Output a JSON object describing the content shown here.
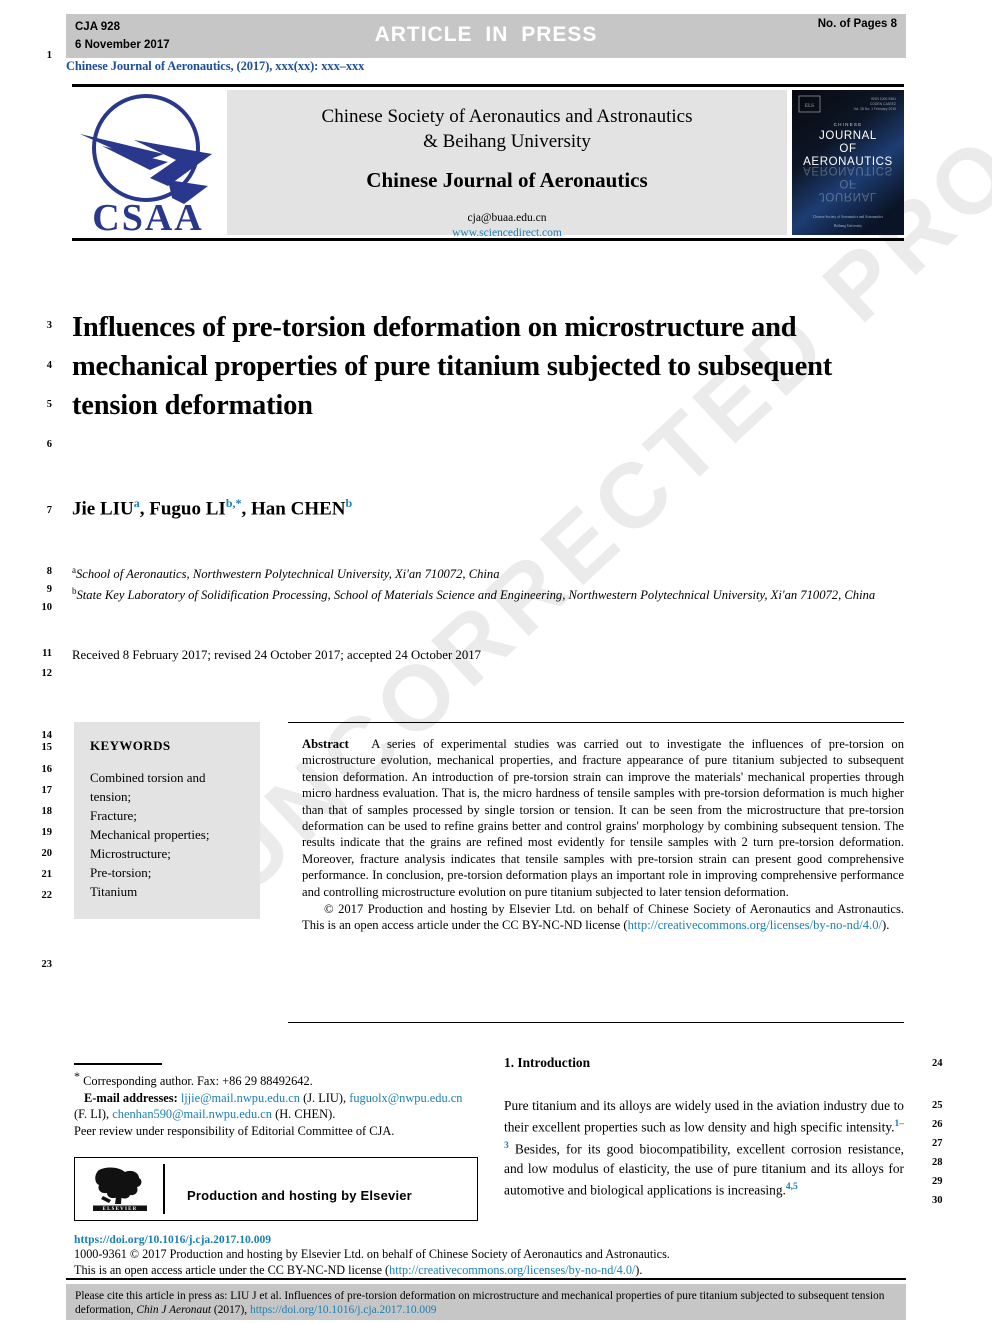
{
  "header": {
    "article_id": "CJA 928",
    "date": "6 November 2017",
    "status_banner": "ARTICLE IN PRESS",
    "pages_note": "No. of Pages 8",
    "running_head": "Chinese Journal of Aeronautics, (2017), xxx(xx): xxx–xxx"
  },
  "masthead": {
    "logo_text": "CSAA",
    "society_line1": "Chinese Society of Aeronautics and Astronautics",
    "society_line2": "& Beihang University",
    "journal_title": "Chinese Journal of Aeronautics",
    "email": "cja@buaa.edu.cn",
    "website": "www.sciencedirect.com",
    "cover": {
      "line1": "CHINESE",
      "line2": "JOURNAL",
      "line3": "OF",
      "line4": "AERONAUTICS",
      "footer1": "Chinese Society of Aeronautics and Astronautics",
      "footer2": "Beihang University"
    }
  },
  "article": {
    "title": "Influences of pre-torsion deformation on microstructure and mechanical properties of pure titanium subjected to subsequent tension deformation",
    "authors_html": "Jie LIU a, Fuguo LI b,*, Han CHEN b",
    "authors": [
      {
        "name": "Jie LIU",
        "marks": "a"
      },
      {
        "name": "Fuguo LI",
        "marks": "b,*"
      },
      {
        "name": "Han CHEN",
        "marks": "b"
      }
    ],
    "affiliations": [
      {
        "mark": "a",
        "text": "School of Aeronautics, Northwestern Polytechnical University, Xi'an 710072, China"
      },
      {
        "mark": "b",
        "text": "State Key Laboratory of Solidification Processing, School of Materials Science and Engineering, Northwestern Polytechnical University, Xi'an 710072, China"
      }
    ],
    "history": "Received 8 February 2017; revised 24 October 2017; accepted 24 October 2017"
  },
  "keywords": {
    "heading": "KEYWORDS",
    "items": [
      "Combined torsion and tension;",
      "Fracture;",
      "Mechanical properties;",
      "Microstructure;",
      "Pre-torsion;",
      "Titanium"
    ]
  },
  "abstract": {
    "label": "Abstract",
    "body": "A series of experimental studies was carried out to investigate the influences of pre-torsion on microstructure evolution, mechanical properties, and fracture appearance of pure titanium subjected to subsequent tension deformation. An introduction of pre-torsion strain can improve the materials' mechanical properties through micro hardness evaluation. That is, the micro hardness of tensile samples with pre-torsion deformation is much higher than that of samples processed by single torsion or tension. It can be seen from the microstructure that pre-torsion deformation can be used to refine grains better and control grains' morphology by combining subsequent tension. The results indicate that the grains are refined most evidently for tensile samples with 2 turn pre-torsion deformation. Moreover, fracture analysis indicates that tensile samples with pre-torsion strain can present good comprehensive performance. In conclusion, pre-torsion deformation plays an important role in improving comprehensive performance and controlling microstructure evolution on pure titanium subjected to later tension deformation.",
    "copyright_text": "© 2017 Production and hosting by Elsevier Ltd. on behalf of Chinese Society of Aeronautics and Astronautics. This is an open access article under the CC BY-NC-ND license (",
    "license_link": "http://creativecommons.org/licenses/by-no-nd/4.0/",
    "copyright_tail": ")."
  },
  "footnotes": {
    "corresponding": "Corresponding author. Fax: +86 29 88492642.",
    "email_label": "E-mail addresses:",
    "emails": [
      {
        "address": "ljjie@mail.nwpu.edu.cn",
        "owner": "(J. LIU),"
      },
      {
        "address": "fuguolx@nwpu.edu.cn",
        "owner": "(F. LI),"
      },
      {
        "address": "chenhan590@mail.nwpu.edu.cn",
        "owner": "(H. CHEN)."
      }
    ],
    "peer_review": "Peer review under responsibility of Editorial Committee of CJA.",
    "elsevier_banner": "Production and hosting by Elsevier",
    "elsevier_logo_label": "ELSEVIER"
  },
  "publisher": {
    "doi": "https://doi.org/10.1016/j.cja.2017.10.009",
    "issn_line": "1000-9361 © 2017 Production and hosting by Elsevier Ltd. on behalf of Chinese Society of Aeronautics and Astronautics.",
    "license_prefix": "This is an open access article under the CC BY-NC-ND license (",
    "license_link": "http://creativecommons.org/licenses/by-no-nd/4.0/",
    "license_suffix": ")."
  },
  "introduction": {
    "heading": "1. Introduction",
    "paragraph_a": "Pure titanium and its alloys are widely used in the aviation industry due to their excellent properties such as low density and high specific intensity.",
    "ref_1": "1–3",
    "paragraph_b": "Besides, for its good biocompatibility, excellent corrosion resistance, and low modulus of elasticity, the use of pure titanium and its alloys for automotive and biological applications is increasing.",
    "ref_2": "4,5"
  },
  "cite_footer": {
    "prefix": "Please cite this article in press as: LIU J et al. Influences of pre-torsion deformation on microstructure and mechanical properties of pure titanium subjected to subsequent tension deformation,",
    "journal_abbrev": "Chin J Aeronaut",
    "year": "(2017),",
    "doi": "https://doi.org/10.1016/j.cja.2017.10.009"
  },
  "line_numbers_left": [
    "1",
    "3",
    "4",
    "5",
    "6",
    "7",
    "8",
    "9",
    "10",
    "11",
    "12",
    "14",
    "15",
    "16",
    "17",
    "18",
    "19",
    "20",
    "21",
    "22",
    "23"
  ],
  "line_numbers_right": [
    "24",
    "25",
    "26",
    "27",
    "28",
    "29",
    "30"
  ],
  "watermark": "UNCORRECTED PROOF",
  "colors": {
    "link": "#1a7fb5",
    "runhead": "#1a4f9c",
    "banner_grey": "#c6c6c6",
    "panel_grey": "#e3e3e3",
    "logo_blue": "#29388c"
  }
}
